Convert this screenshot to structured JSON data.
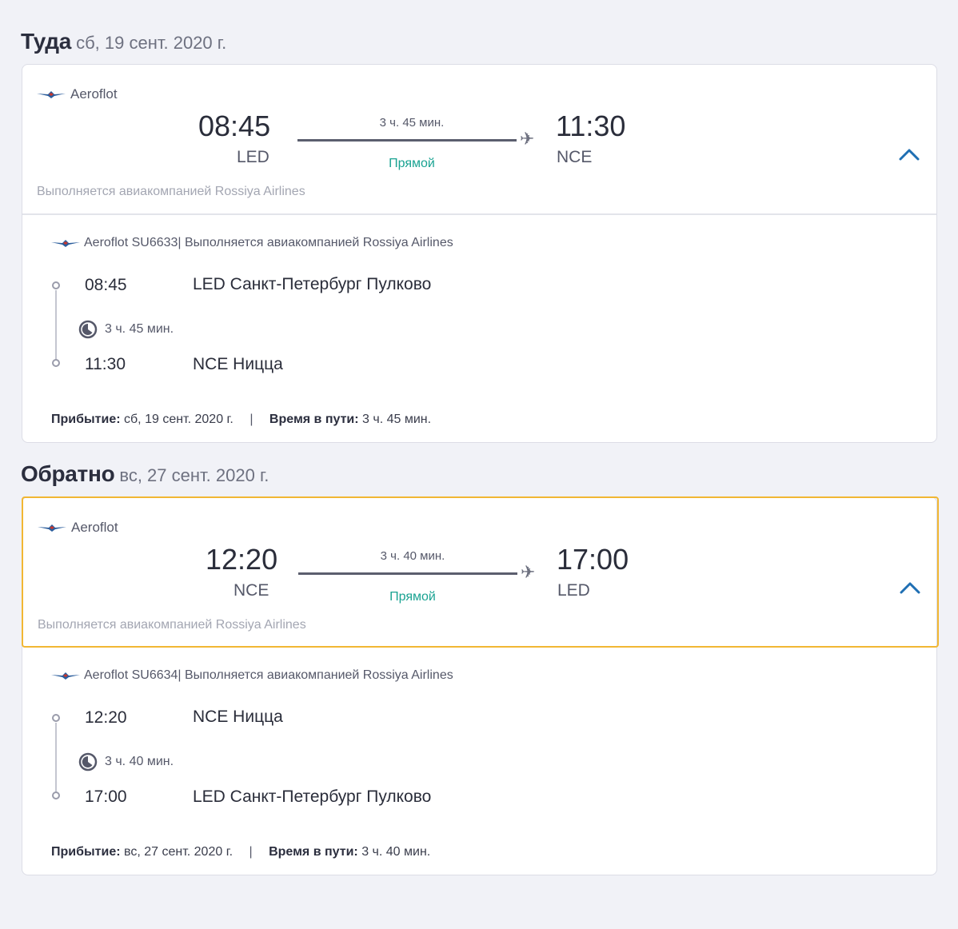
{
  "outbound": {
    "title": "Туда",
    "date": "сб, 19 сент. 2020 г.",
    "airline": "Aeroflot",
    "depart_time": "08:45",
    "depart_code": "LED",
    "arrive_time": "11:30",
    "arrive_code": "NCE",
    "duration": "3 ч. 45 мин.",
    "stops": "Прямой",
    "operated_by": "Выполняется авиакомпанией Rossiya Airlines",
    "segment": {
      "header": "Aeroflot SU6633| Выполняется авиакомпанией Rossiya Airlines",
      "from_time": "08:45",
      "from_place": "LED Санкт-Петербург Пулково",
      "duration": "3 ч. 45 мин.",
      "to_time": "11:30",
      "to_place": "NCE Ницца"
    },
    "arrival_label": "Прибытие:",
    "arrival_value": "сб, 19 сент. 2020 г.",
    "travel_label": "Время в пути:",
    "travel_value": "3 ч. 45 мин."
  },
  "return": {
    "title": "Обратно",
    "date": "вс, 27 сент. 2020 г.",
    "airline": "Aeroflot",
    "depart_time": "12:20",
    "depart_code": "NCE",
    "arrive_time": "17:00",
    "arrive_code": "LED",
    "duration": "3 ч. 40 мин.",
    "stops": "Прямой",
    "operated_by": "Выполняется авиакомпанией Rossiya Airlines",
    "segment": {
      "header": "Aeroflot SU6634| Выполняется авиакомпанией Rossiya Airlines",
      "from_time": "12:20",
      "from_place": "NCE Ницца",
      "duration": "3 ч. 40 мин.",
      "to_time": "17:00",
      "to_place": "LED Санкт-Петербург Пулково"
    },
    "arrival_label": "Прибытие:",
    "arrival_value": "вс, 27 сент. 2020 г.",
    "travel_label": "Время в пути:",
    "travel_value": "3 ч. 40 мин."
  },
  "footer_separator": "|",
  "icons": {
    "airline_logo": "aeroflot-logo-icon",
    "plane": "plane-icon",
    "collapse": "chevron-up-icon",
    "duration": "clock-icon"
  },
  "colors": {
    "accent_teal": "#1aa392",
    "selected_border": "#f1b733",
    "chevron_blue": "#1f6fb3",
    "logo_blue": "#2b5d9c"
  }
}
